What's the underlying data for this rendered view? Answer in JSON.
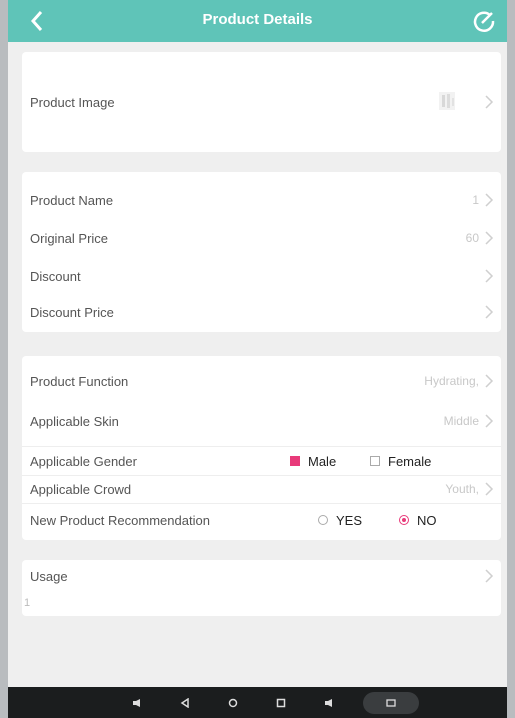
{
  "header": {
    "title": "Product Details",
    "back_icon": "chevron-left-icon",
    "edit_icon": "edit-circle-icon",
    "color": "#5fc4b8"
  },
  "image_section": {
    "label": "Product Image"
  },
  "basic_info": [
    {
      "label": "Product Name",
      "value": "1"
    },
    {
      "label": "Original Price",
      "value": "60"
    },
    {
      "label": "Discount",
      "value": ""
    },
    {
      "label": "Discount Price",
      "value": ""
    }
  ],
  "attributes": {
    "function": {
      "label": "Product Function",
      "value": "Hydrating,"
    },
    "skin": {
      "label": "Applicable Skin",
      "value": "Middle"
    },
    "gender": {
      "label": "Applicable Gender",
      "options": [
        {
          "label": "Male",
          "checked": true
        },
        {
          "label": "Female",
          "checked": false
        }
      ]
    },
    "crowd": {
      "label": "Applicable Crowd",
      "value": "Youth,"
    },
    "recommendation": {
      "label": "New Product Recommendation",
      "options": [
        {
          "label": "YES",
          "selected": false
        },
        {
          "label": "NO",
          "selected": true
        }
      ]
    }
  },
  "usage": {
    "label": "Usage",
    "value": "1"
  },
  "accent_color": "#e83a7a"
}
